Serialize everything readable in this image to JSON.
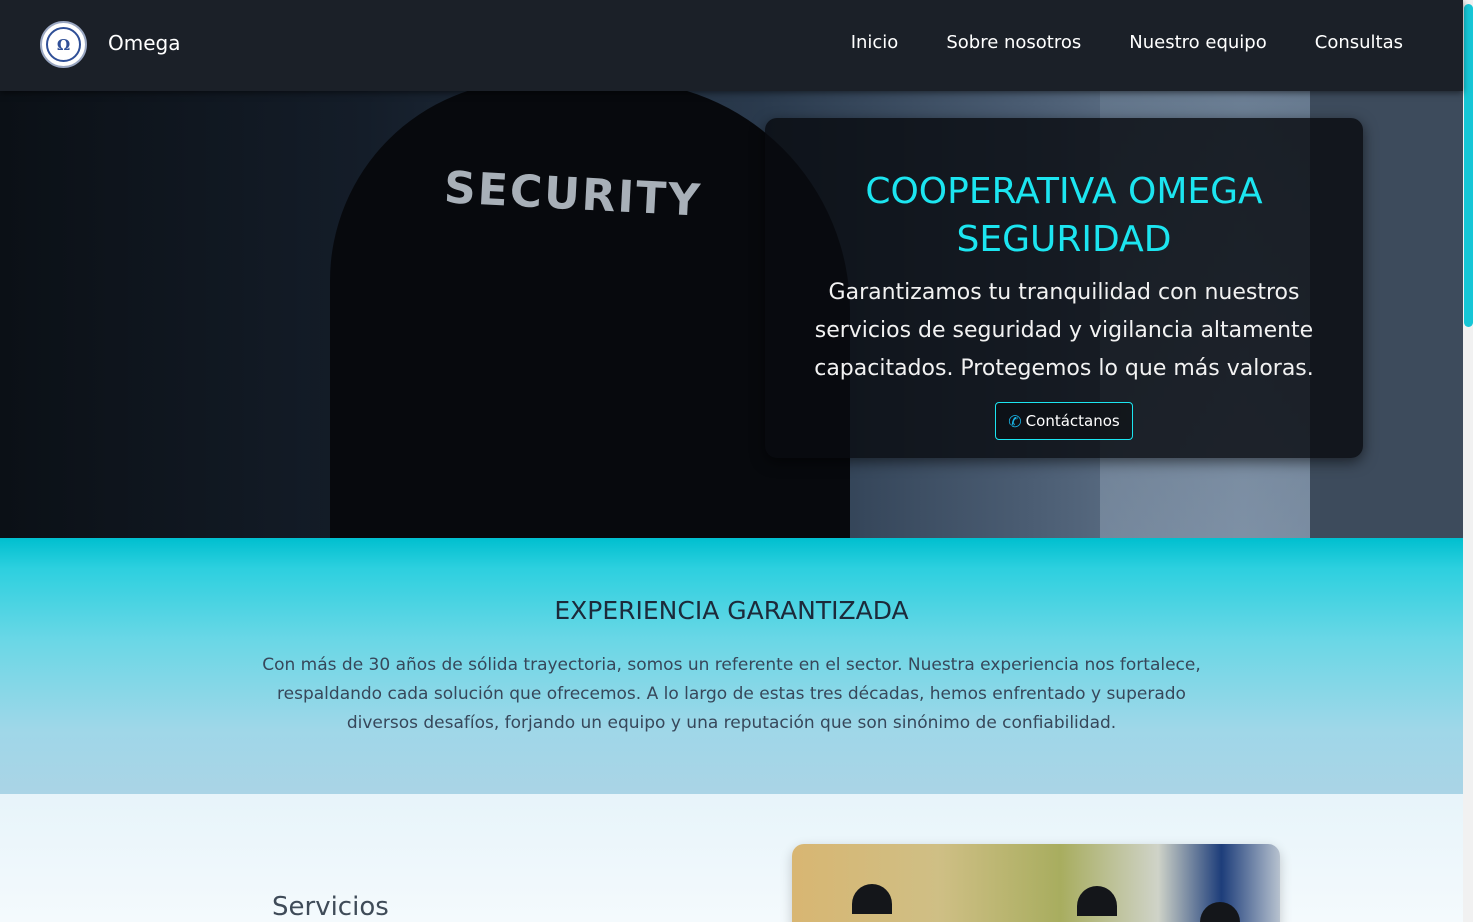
{
  "nav": {
    "brand": "Omega",
    "logo_glyph": "Ω",
    "links": [
      "Inicio",
      "Sobre nosotros",
      "Nuestro equipo",
      "Consultas"
    ]
  },
  "hero": {
    "image_text": "SECURITY",
    "title_line1": "COOPERATIVA OMEGA",
    "title_line2": "SEGURIDAD",
    "text": "Garantizamos tu tranquilidad con nuestros servicios de seguridad y vigilancia altamente capacitados. Protegemos lo que más valoras.",
    "button_label": "Contáctanos",
    "button_icon": "phone-icon"
  },
  "experience": {
    "title": "EXPERIENCIA GARANTIZADA",
    "text": "Con más de 30 años de sólida trayectoria, somos un referente en el sector. Nuestra experiencia nos fortalece, respaldando cada solución que ofrecemos. A lo largo de estas tres décadas, hemos enfrentado y superado diversos desafíos, forjando un equipo y una reputación que son sinónimo de confiabilidad."
  },
  "services": {
    "title": "Servicios"
  },
  "colors": {
    "navbar": "#1b2028",
    "accent": "#1ce5f0",
    "experience_bg": "#2dd0df"
  }
}
